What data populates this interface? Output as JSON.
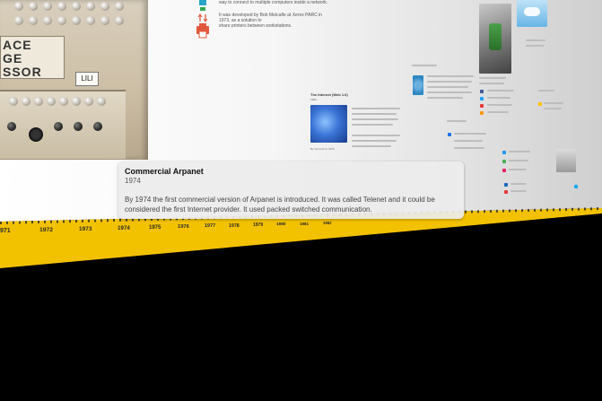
{
  "popup": {
    "title": "Commercial Arpanet",
    "year": "1974",
    "body": "By 1974 the first commercial version of Arpanet is introduced. It was called Telenet and it could be considered the first Internet provider. It used packed switched communication."
  },
  "timeline": {
    "years": [
      "971",
      "1972",
      "1973",
      "1974",
      "1975",
      "1976",
      "1977",
      "1978",
      "1979",
      "1980",
      "1981",
      "1982"
    ]
  },
  "entry": {
    "text_lines": [
      "way to connect to multiple computers inside a network.",
      "It was developed by Bob Metcalfe at Xerox PARC in 1973, as a solution to",
      "share printers between workstations."
    ]
  },
  "machine_photo": {
    "label_line1": "ACE",
    "label_line2": "GE",
    "label_line3": "SSOR",
    "tag": "LILI"
  },
  "internet_card": {
    "heading": "The Internet (Web 1.0)",
    "year": "1983",
    "caption": "By Vint Cerf in 1976"
  },
  "colors": {
    "timeline_band": "#f2c200",
    "popup_bg": "#ececec",
    "background": "#000000"
  }
}
